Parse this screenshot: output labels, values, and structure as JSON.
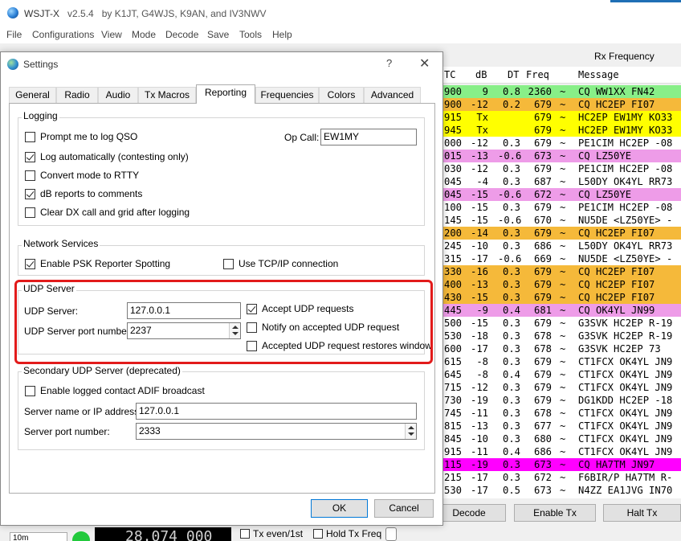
{
  "main_window": {
    "title": "WSJT-X",
    "version": "v2.5.4",
    "authors": "by K1JT, G4WJS, K9AN, and IV3NWV",
    "menu": [
      "File",
      "Configurations",
      "View",
      "Mode",
      "Decode",
      "Save",
      "Tools",
      "Help"
    ],
    "rx_title": "Rx Frequency",
    "columns": {
      "utc": "TC",
      "db": "dB",
      "dt": "DT",
      "freq": "Freq",
      "message": "Message"
    },
    "rows": [
      {
        "utc": "900",
        "db": "9",
        "dt": "0.8",
        "freq": "2360",
        "sep": "~",
        "msg": "CQ WW1XX FN42",
        "bg": "#88ef88"
      },
      {
        "utc": "900",
        "db": "-12",
        "dt": "0.2",
        "freq": "679",
        "sep": "~",
        "msg": "CQ HC2EP FI07",
        "bg": "#f5b93a"
      },
      {
        "utc": "915",
        "db": "Tx",
        "dt": "",
        "freq": "679",
        "sep": "~",
        "msg": "HC2EP EW1MY KO33",
        "bg": "#ffff00"
      },
      {
        "utc": "945",
        "db": "Tx",
        "dt": "",
        "freq": "679",
        "sep": "~",
        "msg": "HC2EP EW1MY KO33",
        "bg": "#ffff00"
      },
      {
        "utc": "000",
        "db": "-12",
        "dt": "0.3",
        "freq": "679",
        "sep": "~",
        "msg": "PE1CIM HC2EP -08",
        "bg": "#ffffff"
      },
      {
        "utc": "015",
        "db": "-13",
        "dt": "-0.6",
        "freq": "673",
        "sep": "~",
        "msg": "CQ LZ50YE",
        "bg": "#ee9ce8"
      },
      {
        "utc": "030",
        "db": "-12",
        "dt": "0.3",
        "freq": "679",
        "sep": "~",
        "msg": "PE1CIM HC2EP -08",
        "bg": "#ffffff"
      },
      {
        "utc": "045",
        "db": "-4",
        "dt": "0.3",
        "freq": "687",
        "sep": "~",
        "msg": "L50DY OK4YL RR73",
        "bg": "#ffffff"
      },
      {
        "utc": "045",
        "db": "-15",
        "dt": "-0.6",
        "freq": "672",
        "sep": "~",
        "msg": "CQ LZ50YE",
        "bg": "#ee9ce8"
      },
      {
        "utc": "100",
        "db": "-15",
        "dt": "0.3",
        "freq": "679",
        "sep": "~",
        "msg": "PE1CIM HC2EP -08",
        "bg": "#ffffff"
      },
      {
        "utc": "145",
        "db": "-15",
        "dt": "-0.6",
        "freq": "670",
        "sep": "~",
        "msg": "NU5DE <LZ50YE> -",
        "bg": "#ffffff"
      },
      {
        "utc": "200",
        "db": "-14",
        "dt": "0.3",
        "freq": "679",
        "sep": "~",
        "msg": "CQ HC2EP FI07",
        "bg": "#f5b93a"
      },
      {
        "utc": "245",
        "db": "-10",
        "dt": "0.3",
        "freq": "686",
        "sep": "~",
        "msg": "L50DY OK4YL RR73",
        "bg": "#ffffff"
      },
      {
        "utc": "315",
        "db": "-17",
        "dt": "-0.6",
        "freq": "669",
        "sep": "~",
        "msg": "NU5DE <LZ50YE> -",
        "bg": "#ffffff"
      },
      {
        "utc": "330",
        "db": "-16",
        "dt": "0.3",
        "freq": "679",
        "sep": "~",
        "msg": "CQ HC2EP FI07",
        "bg": "#f5b93a"
      },
      {
        "utc": "400",
        "db": "-13",
        "dt": "0.3",
        "freq": "679",
        "sep": "~",
        "msg": "CQ HC2EP FI07",
        "bg": "#f5b93a"
      },
      {
        "utc": "430",
        "db": "-15",
        "dt": "0.3",
        "freq": "679",
        "sep": "~",
        "msg": "CQ HC2EP FI07",
        "bg": "#f5b93a"
      },
      {
        "utc": "445",
        "db": "-9",
        "dt": "0.4",
        "freq": "681",
        "sep": "~",
        "msg": "CQ OK4YL JN99",
        "bg": "#ee9ce8"
      },
      {
        "utc": "500",
        "db": "-15",
        "dt": "0.3",
        "freq": "679",
        "sep": "~",
        "msg": "G3SVK HC2EP R-19",
        "bg": "#ffffff"
      },
      {
        "utc": "530",
        "db": "-18",
        "dt": "0.3",
        "freq": "678",
        "sep": "~",
        "msg": "G3SVK HC2EP R-19",
        "bg": "#ffffff"
      },
      {
        "utc": "600",
        "db": "-17",
        "dt": "0.3",
        "freq": "678",
        "sep": "~",
        "msg": "G3SVK HC2EP 73",
        "bg": "#ffffff"
      },
      {
        "utc": "615",
        "db": "-8",
        "dt": "0.3",
        "freq": "679",
        "sep": "~",
        "msg": "CT1FCX OK4YL JN9",
        "bg": "#ffffff"
      },
      {
        "utc": "645",
        "db": "-8",
        "dt": "0.4",
        "freq": "679",
        "sep": "~",
        "msg": "CT1FCX OK4YL JN9",
        "bg": "#ffffff"
      },
      {
        "utc": "715",
        "db": "-12",
        "dt": "0.3",
        "freq": "679",
        "sep": "~",
        "msg": "CT1FCX OK4YL JN9",
        "bg": "#ffffff"
      },
      {
        "utc": "730",
        "db": "-19",
        "dt": "0.3",
        "freq": "679",
        "sep": "~",
        "msg": "DG1KDD HC2EP -18",
        "bg": "#ffffff"
      },
      {
        "utc": "745",
        "db": "-11",
        "dt": "0.3",
        "freq": "678",
        "sep": "~",
        "msg": "CT1FCX OK4YL JN9",
        "bg": "#ffffff"
      },
      {
        "utc": "815",
        "db": "-13",
        "dt": "0.3",
        "freq": "677",
        "sep": "~",
        "msg": "CT1FCX OK4YL JN9",
        "bg": "#ffffff"
      },
      {
        "utc": "845",
        "db": "-10",
        "dt": "0.3",
        "freq": "680",
        "sep": "~",
        "msg": "CT1FCX OK4YL JN9",
        "bg": "#ffffff"
      },
      {
        "utc": "915",
        "db": "-11",
        "dt": "0.4",
        "freq": "686",
        "sep": "~",
        "msg": "CT1FCX OK4YL JN9",
        "bg": "#ffffff"
      },
      {
        "utc": "115",
        "db": "-19",
        "dt": "0.3",
        "freq": "673",
        "sep": "~",
        "msg": "CQ HA7TM JN97",
        "bg": "#ff00ff"
      },
      {
        "utc": "215",
        "db": "-17",
        "dt": "0.3",
        "freq": "672",
        "sep": "~",
        "msg": "F6BIR/P HA7TM R-",
        "bg": "#ffffff"
      },
      {
        "utc": "530",
        "db": "-17",
        "dt": "0.5",
        "freq": "673",
        "sep": "~",
        "msg": "N4ZZ EA1JVG IN70",
        "bg": "#ffffff"
      }
    ],
    "buttons": {
      "decode": "Decode",
      "enable_tx": "Enable Tx",
      "halt_tx": "Halt Tx"
    },
    "band": "10m",
    "frequency": "28.074 000",
    "tx_even_label": "Tx even/1st",
    "hold_tx_label": "Hold Tx Freq",
    "led_color": "#22c93c"
  },
  "settings": {
    "title": "Settings",
    "help": "?",
    "close": "✕",
    "tabs": [
      "General",
      "Radio",
      "Audio",
      "Tx Macros",
      "Reporting",
      "Frequencies",
      "Colors",
      "Advanced"
    ],
    "active_tab": "Reporting",
    "logging": {
      "title": "Logging",
      "prompt_log": {
        "label": "Prompt me to log QSO",
        "checked": false
      },
      "log_auto": {
        "label": "Log automatically (contesting only)",
        "checked": true
      },
      "rtty": {
        "label": "Convert mode to RTTY",
        "checked": false
      },
      "db_reports": {
        "label": "dB reports to comments",
        "checked": true
      },
      "clear_dx": {
        "label": "Clear DX call and grid after logging",
        "checked": false
      },
      "op_call_label": "Op Call:",
      "op_call_value": "EW1MY"
    },
    "network": {
      "title": "Network Services",
      "psk": {
        "label": "Enable PSK Reporter Spotting",
        "checked": true
      },
      "tcpip": {
        "label": "Use TCP/IP connection",
        "checked": false
      }
    },
    "udp": {
      "title": "UDP Server",
      "server_label": "UDP Server:",
      "server_value": "127.0.0.1",
      "port_label": "UDP Server port number:",
      "port_value": "2237",
      "accept": {
        "label": "Accept UDP requests",
        "checked": true
      },
      "notify": {
        "label": "Notify on accepted UDP request",
        "checked": false
      },
      "restore": {
        "label": "Accepted UDP request restores window",
        "checked": false
      },
      "highlight_color": "#e21b1b"
    },
    "secondary": {
      "title": "Secondary UDP Server (deprecated)",
      "adif": {
        "label": "Enable logged contact ADIF broadcast",
        "checked": false
      },
      "name_label": "Server name or IP address:",
      "name_value": "127.0.0.1",
      "port_label": "Server port number:",
      "port_value": "2333"
    },
    "ok": "OK",
    "cancel": "Cancel"
  }
}
